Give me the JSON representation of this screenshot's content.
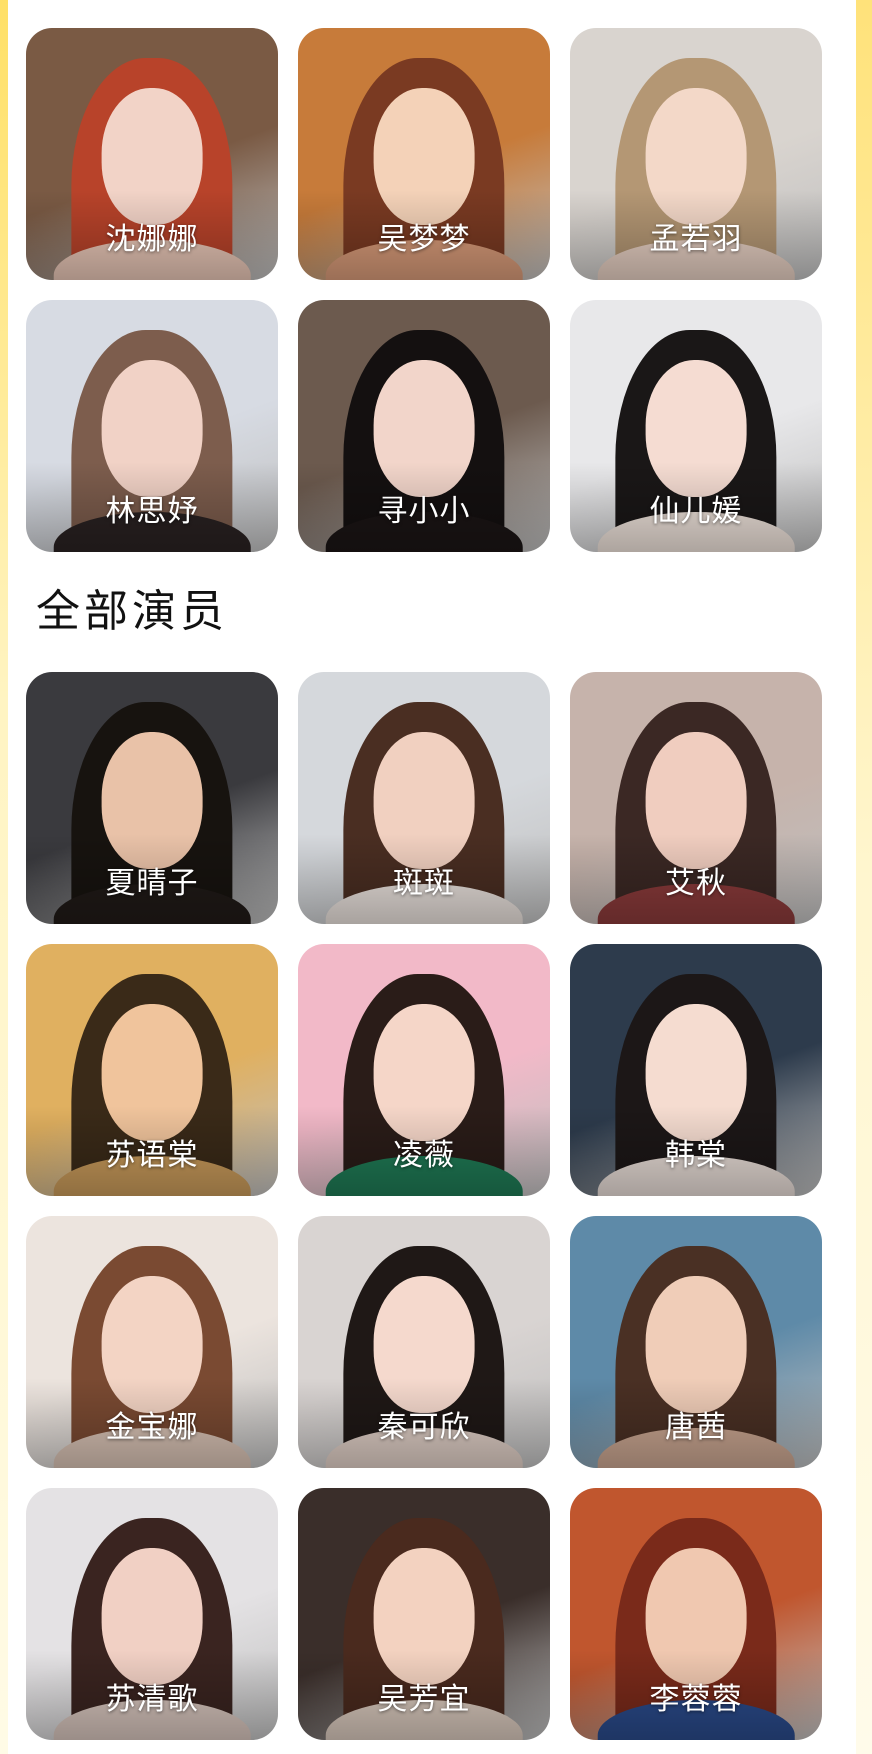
{
  "featured": {
    "performers": [
      {
        "name": "沈娜娜",
        "bg": "#7a5a44",
        "hair": "#b8432a",
        "skin": "#f2d3c7",
        "cloth": "#e8c6b6"
      },
      {
        "name": "吴梦梦",
        "bg": "#c77b3a",
        "hair": "#7a3a22",
        "skin": "#f4d2b8",
        "cloth": "#d79a78"
      },
      {
        "name": "孟若羽",
        "bg": "#d9d4cf",
        "hair": "#b49774",
        "skin": "#f3d8c8",
        "cloth": "#e6cfc2"
      },
      {
        "name": "林思妤",
        "bg": "#d7dbe3",
        "hair": "#7d5d4d",
        "skin": "#f1d2c6",
        "cloth": "#2a2222"
      },
      {
        "name": "寻小小",
        "bg": "#6c5a4e",
        "hair": "#141010",
        "skin": "#f2d5ca",
        "cloth": "#1b1515"
      },
      {
        "name": "仙儿媛",
        "bg": "#e8e8ea",
        "hair": "#1a1717",
        "skin": "#f5dcd2",
        "cloth": "#f0e4dc"
      }
    ]
  },
  "all_section": {
    "title": "全部演员",
    "performers": [
      {
        "name": "夏晴子",
        "bg": "#3a3a3e",
        "hair": "#17130f",
        "skin": "#e9c2a8",
        "cloth": "#201a17"
      },
      {
        "name": "斑斑",
        "bg": "#d5d8dc",
        "hair": "#4a2e22",
        "skin": "#f1d0c0",
        "cloth": "#e9e1dc"
      },
      {
        "name": "艾秋",
        "bg": "#c6b3ab",
        "hair": "#3b2824",
        "skin": "#f0cdbf",
        "cloth": "#8a3a3a"
      },
      {
        "name": "苏语棠",
        "bg": "#e0b060",
        "hair": "#3a2a18",
        "skin": "#f0c49c",
        "cloth": "#c89a5a"
      },
      {
        "name": "凌薇",
        "bg": "#f2b9c8",
        "hair": "#2a1c18",
        "skin": "#f5d6c8",
        "cloth": "#1f7a55"
      },
      {
        "name": "韩棠",
        "bg": "#2d3b4c",
        "hair": "#1c1717",
        "skin": "#f5dcd0",
        "cloth": "#e7dcd6"
      },
      {
        "name": "金宝娜",
        "bg": "#ece4de",
        "hair": "#7a4a32",
        "skin": "#f3d4c4",
        "cloth": "#d8c2b4"
      },
      {
        "name": "秦可欣",
        "bg": "#d9d4d2",
        "hair": "#1f1816",
        "skin": "#f5d9cd",
        "cloth": "#e0cfc6"
      },
      {
        "name": "唐茜",
        "bg": "#5e8aa8",
        "hair": "#4a3024",
        "skin": "#f0cdb8",
        "cloth": "#c9a590"
      },
      {
        "name": "苏清歌",
        "bg": "#e4e2e4",
        "hair": "#3a2420",
        "skin": "#f1d0c4",
        "cloth": "#d6c4bc"
      },
      {
        "name": "吴芳宜",
        "bg": "#3a2e2a",
        "hair": "#4a2a1e",
        "skin": "#f3d2c0",
        "cloth": "#d8c8bc"
      },
      {
        "name": "李蓉蓉",
        "bg": "#c0562e",
        "hair": "#7a2a1a",
        "skin": "#f0c8b0",
        "cloth": "#2a4a8a"
      }
    ]
  },
  "colors": {
    "page_bg": "#ffffff",
    "edge_accent": "#ffe066",
    "title_text": "#111111",
    "name_text": "#ffffff"
  }
}
